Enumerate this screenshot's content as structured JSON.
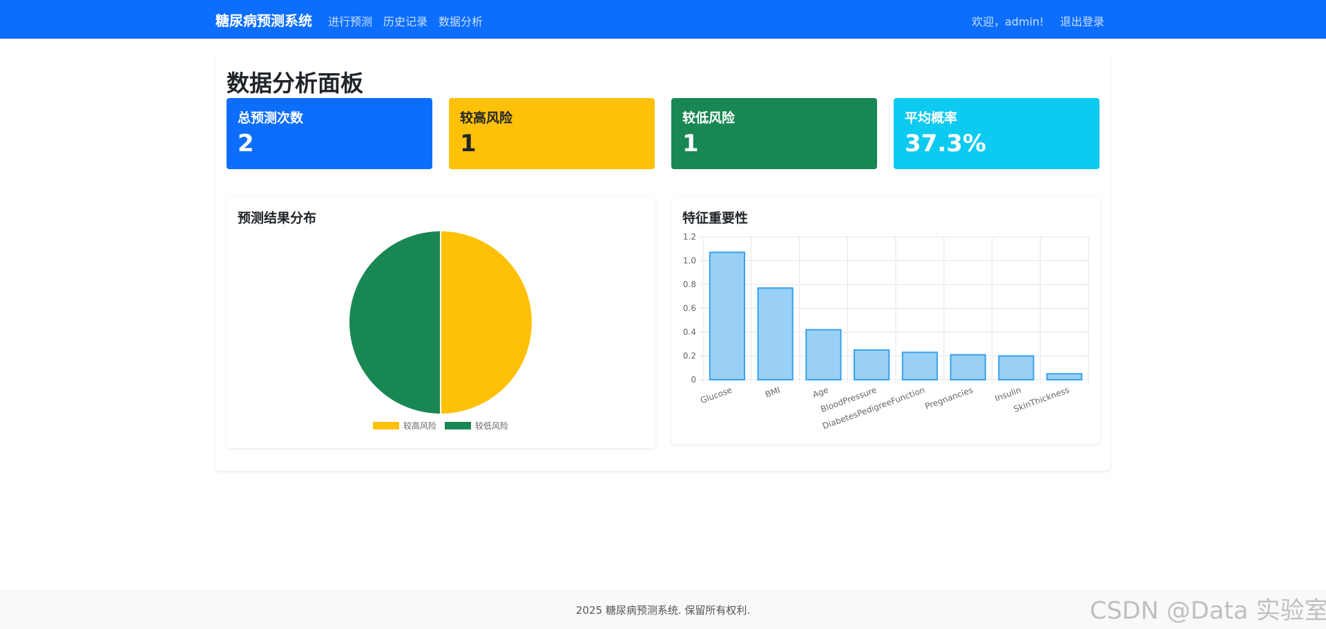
{
  "navbar": {
    "brand": "糖尿病预测系统",
    "links": [
      "进行预测",
      "历史记录",
      "数据分析"
    ],
    "welcome": "欢迎，admin!",
    "logout": "退出登录",
    "color": "#0d6efd"
  },
  "page": {
    "title": "数据分析面板"
  },
  "stats": [
    {
      "label": "总预测次数",
      "value": "2",
      "color": "#0d6efd",
      "text_color": "#ffffff"
    },
    {
      "label": "较高风险",
      "value": "1",
      "color": "#ffc107",
      "text_color": "#212529"
    },
    {
      "label": "较低风险",
      "value": "1",
      "color": "#198754",
      "text_color": "#ffffff"
    },
    {
      "label": "平均概率",
      "value": "37.3%",
      "color": "#0dcaf0",
      "text_color": "#ffffff"
    }
  ],
  "pie_card": {
    "title": "预测结果分布"
  },
  "bar_card": {
    "title": "特征重要性"
  },
  "chart_data": [
    {
      "type": "pie",
      "title": "预测结果分布",
      "labels": [
        "较高风险",
        "较低风险"
      ],
      "values": [
        1,
        1
      ],
      "colors": [
        "#ffc107",
        "#198754"
      ],
      "legend": "bottom"
    },
    {
      "type": "bar",
      "title": "特征重要性",
      "categories": [
        "Glucose",
        "BMI",
        "Age",
        "BloodPressure",
        "DiabetesPedigreeFunction",
        "Pregnancies",
        "Insulin",
        "SkinThickness"
      ],
      "values": [
        1.07,
        0.77,
        0.42,
        0.25,
        0.23,
        0.21,
        0.2,
        0.05
      ],
      "ylim": [
        0,
        1.2
      ],
      "yticks": [
        "0",
        "0.2",
        "0.4",
        "0.6",
        "0.8",
        "1.0",
        "1.2"
      ],
      "grid": true,
      "bar_color": "#9ad0f5",
      "bar_border": "#36a2eb"
    }
  ],
  "footer": {
    "text": "2025 糖尿病预测系统. 保留所有权利."
  },
  "watermark": "CSDN @Data 实验室"
}
